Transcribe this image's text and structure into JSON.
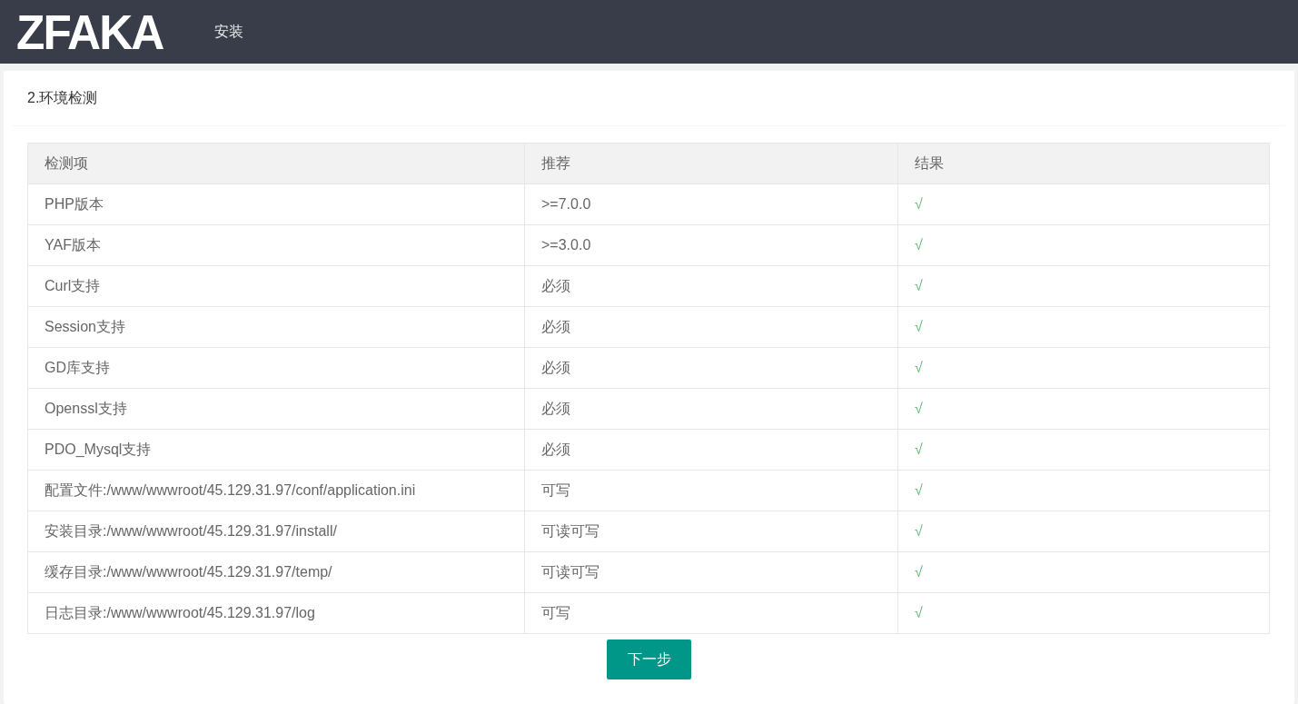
{
  "header": {
    "logo": "ZFAKA",
    "nav": [
      {
        "label": "安装"
      }
    ]
  },
  "card": {
    "title": "2.环境检测"
  },
  "table": {
    "columns": [
      "检测项",
      "推荐",
      "结果"
    ],
    "rows": [
      {
        "item": "PHP版本",
        "recommend": ">=7.0.0",
        "result": "√"
      },
      {
        "item": "YAF版本",
        "recommend": ">=3.0.0",
        "result": "√"
      },
      {
        "item": "Curl支持",
        "recommend": "必须",
        "result": "√"
      },
      {
        "item": "Session支持",
        "recommend": "必须",
        "result": "√"
      },
      {
        "item": "GD库支持",
        "recommend": "必须",
        "result": "√"
      },
      {
        "item": "Openssl支持",
        "recommend": "必须",
        "result": "√"
      },
      {
        "item": "PDO_Mysql支持",
        "recommend": "必须",
        "result": "√"
      },
      {
        "item": "配置文件:/www/wwwroot/45.129.31.97/conf/application.ini",
        "recommend": "可写",
        "result": "√"
      },
      {
        "item": "安装目录:/www/wwwroot/45.129.31.97/install/",
        "recommend": "可读可写",
        "result": "√"
      },
      {
        "item": "缓存目录:/www/wwwroot/45.129.31.97/temp/",
        "recommend": "可读可写",
        "result": "√"
      },
      {
        "item": "日志目录:/www/wwwroot/45.129.31.97/log",
        "recommend": "可写",
        "result": "√"
      }
    ]
  },
  "button": "下一步"
}
